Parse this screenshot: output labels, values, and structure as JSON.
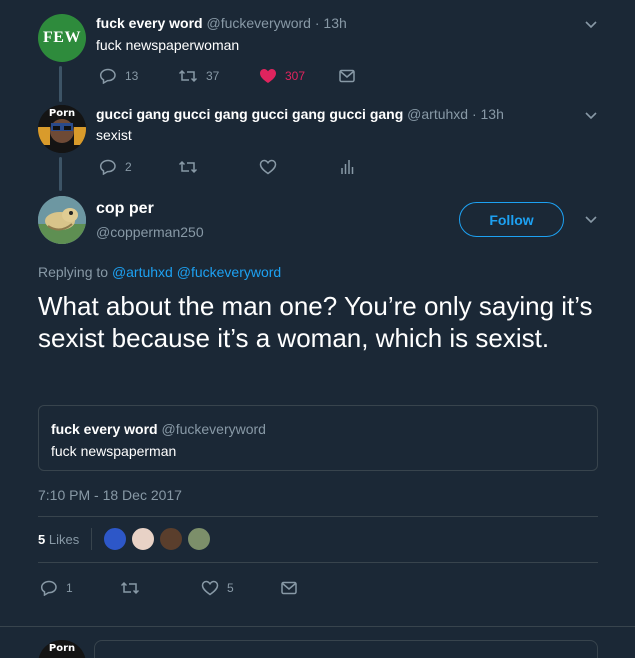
{
  "tweet1": {
    "avatar_text": "FEW",
    "name": "fuck every word",
    "handle": "@fuckeveryword · 13h",
    "text": "fuck newspaperwoman",
    "replies": "13",
    "retweets": "37",
    "likes": "307"
  },
  "tweet2": {
    "name": "gucci gang gucci gang gucci gang gucci gang",
    "handle": "@artuhxd · 13h",
    "text": "sexist",
    "replies": "2"
  },
  "tweet3": {
    "name": "cop per",
    "handle": "@copperman250",
    "follow_label": "Follow",
    "replying_prefix": "Replying to",
    "replying_to_1": "@artuhxd",
    "replying_to_2": "@fuckeveryword",
    "text": "What about the man one? You’re only saying it’s sexist because it’s a woman, which is sexist.",
    "quote": {
      "name": "fuck every word",
      "handle": "@fuckeveryword",
      "text": "fuck newspaperman"
    },
    "timestamp": "7:10 PM - 18 Dec 2017",
    "likes_count": "5",
    "likes_label": "Likes",
    "replies": "1",
    "likes": "5"
  },
  "colors": {
    "background": "#1b2836",
    "accent": "#1da1f2",
    "like": "#e0245e",
    "muted": "#8899a6"
  }
}
